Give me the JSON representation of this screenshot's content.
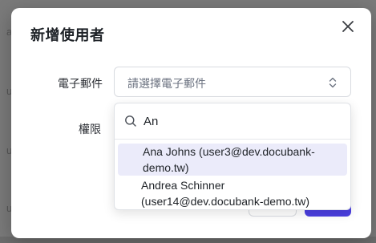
{
  "backdrop": {
    "letters": [
      "a",
      "u",
      "u",
      "u"
    ]
  },
  "modal": {
    "title": "新增使用者",
    "close_icon": "close-icon"
  },
  "form": {
    "email_label": "電子郵件",
    "email_placeholder": "請選擇電子郵件",
    "permission_label": "權限"
  },
  "dropdown": {
    "search_value": "An",
    "options": [
      {
        "line1": "Ana Johns (user3@dev.docubank-",
        "line2": "demo.tw)",
        "highlighted": true
      },
      {
        "line1": "Andrea Schinner",
        "line2": "(user14@dev.docubank-demo.tw)",
        "highlighted": false
      }
    ]
  },
  "colors": {
    "accent": "#4b3fe0",
    "highlight": "#ebebfa",
    "backdrop": "#7a7a7a"
  }
}
